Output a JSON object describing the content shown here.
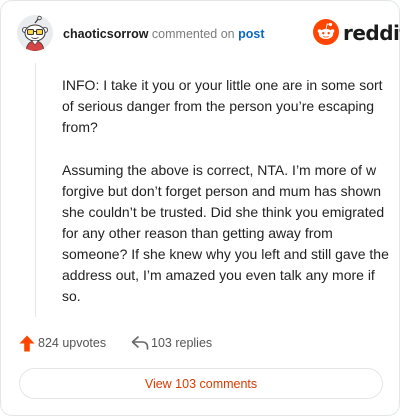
{
  "header": {
    "username": "chaoticsorrow",
    "action_text": "commented on",
    "link_text": "post",
    "brand": "reddit"
  },
  "comment": {
    "paragraphs": [
      "INFO: I take it you or your little one are in some sort of serious danger from the person you’re escaping from?",
      "Assuming the above is correct, NTA. I’m more of w forgive but don’t forget person and mum has shown she couldn’t be trusted. Did she think you emigrated for any other reason than getting away from someone? If she knew why you left and still gave the address out, I’m amazed you even talk any more if so."
    ]
  },
  "actions": {
    "upvotes": "824 upvotes",
    "replies": "103 replies"
  },
  "view_button": "View 103 comments",
  "colors": {
    "accent": "#d93a00",
    "upvote": "#ff4500",
    "link": "#0b66c2"
  },
  "icons": [
    "snoo-avatar-icon",
    "reddit-logo-icon",
    "upvote-arrow-icon",
    "reply-arrow-icon"
  ]
}
